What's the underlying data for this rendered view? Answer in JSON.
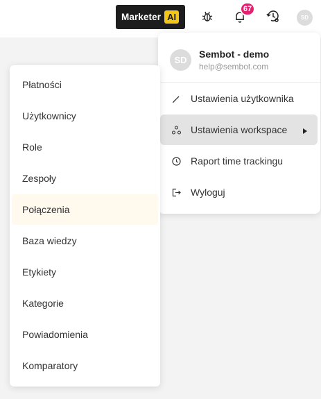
{
  "topbar": {
    "marketer_label": "Marketer",
    "ai_label": "AI",
    "notifications_count": "67",
    "avatar_initials": "SD"
  },
  "user_menu": {
    "avatar_initials": "SD",
    "name": "Sembot - demo",
    "email": "help@sembot.com",
    "items": [
      {
        "label": "Ustawienia użytkownika",
        "icon": "pencil-icon"
      },
      {
        "label": "Ustawienia workspace",
        "icon": "workspace-icon",
        "active": true
      },
      {
        "label": "Raport time trackingu",
        "icon": "clock-icon"
      },
      {
        "label": "Wyloguj",
        "icon": "logout-icon"
      }
    ]
  },
  "workspace_submenu": {
    "items": [
      {
        "label": "Płatności"
      },
      {
        "label": "Użytkownicy"
      },
      {
        "label": "Role"
      },
      {
        "label": "Zespoły"
      },
      {
        "label": "Połączenia",
        "hover": true
      },
      {
        "label": "Baza wiedzy"
      },
      {
        "label": "Etykiety"
      },
      {
        "label": "Kategorie"
      },
      {
        "label": "Powiadomienia"
      },
      {
        "label": "Komparatory"
      }
    ]
  },
  "colors": {
    "accent_yellow": "#f5c518",
    "badge_pink": "#e5216f",
    "dark": "#1d1d1d"
  }
}
